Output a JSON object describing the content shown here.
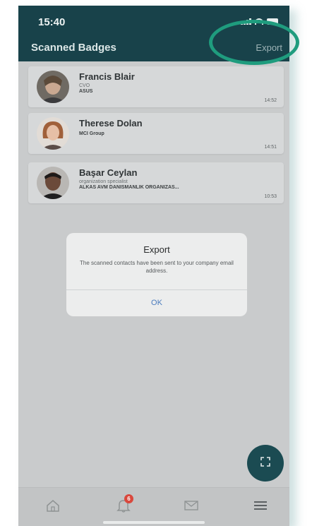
{
  "status_bar": {
    "time": "15:40"
  },
  "header": {
    "title": "Scanned Badges",
    "export_label": "Export"
  },
  "contacts": [
    {
      "name": "Francis Blair",
      "role": "CVO",
      "company": "ASUS",
      "time": "14:52"
    },
    {
      "name": "Therese Dolan",
      "role": "",
      "company": "MCI Group",
      "time": "14:51"
    },
    {
      "name": "Başar Ceylan",
      "role": "organization specialist",
      "company": "ALKAS AVM DANISMANLIK ORGANIZAS...",
      "time": "10:53"
    }
  ],
  "dialog": {
    "title": "Export",
    "message": "The scanned contacts have been sent to your company email address.",
    "ok_label": "OK"
  },
  "bottom_nav": {
    "notification_count": "6"
  },
  "icons": {
    "fab": "scan-frame-icon",
    "nav": [
      "home-icon",
      "bell-icon",
      "mail-icon",
      "menu-icon"
    ]
  },
  "colors": {
    "header_bg": "#18424a",
    "highlight_ring": "#1f9c7e",
    "fab_bg": "#1b4b52",
    "badge": "#d9483d",
    "dialog_ok": "#4a7bbd"
  }
}
